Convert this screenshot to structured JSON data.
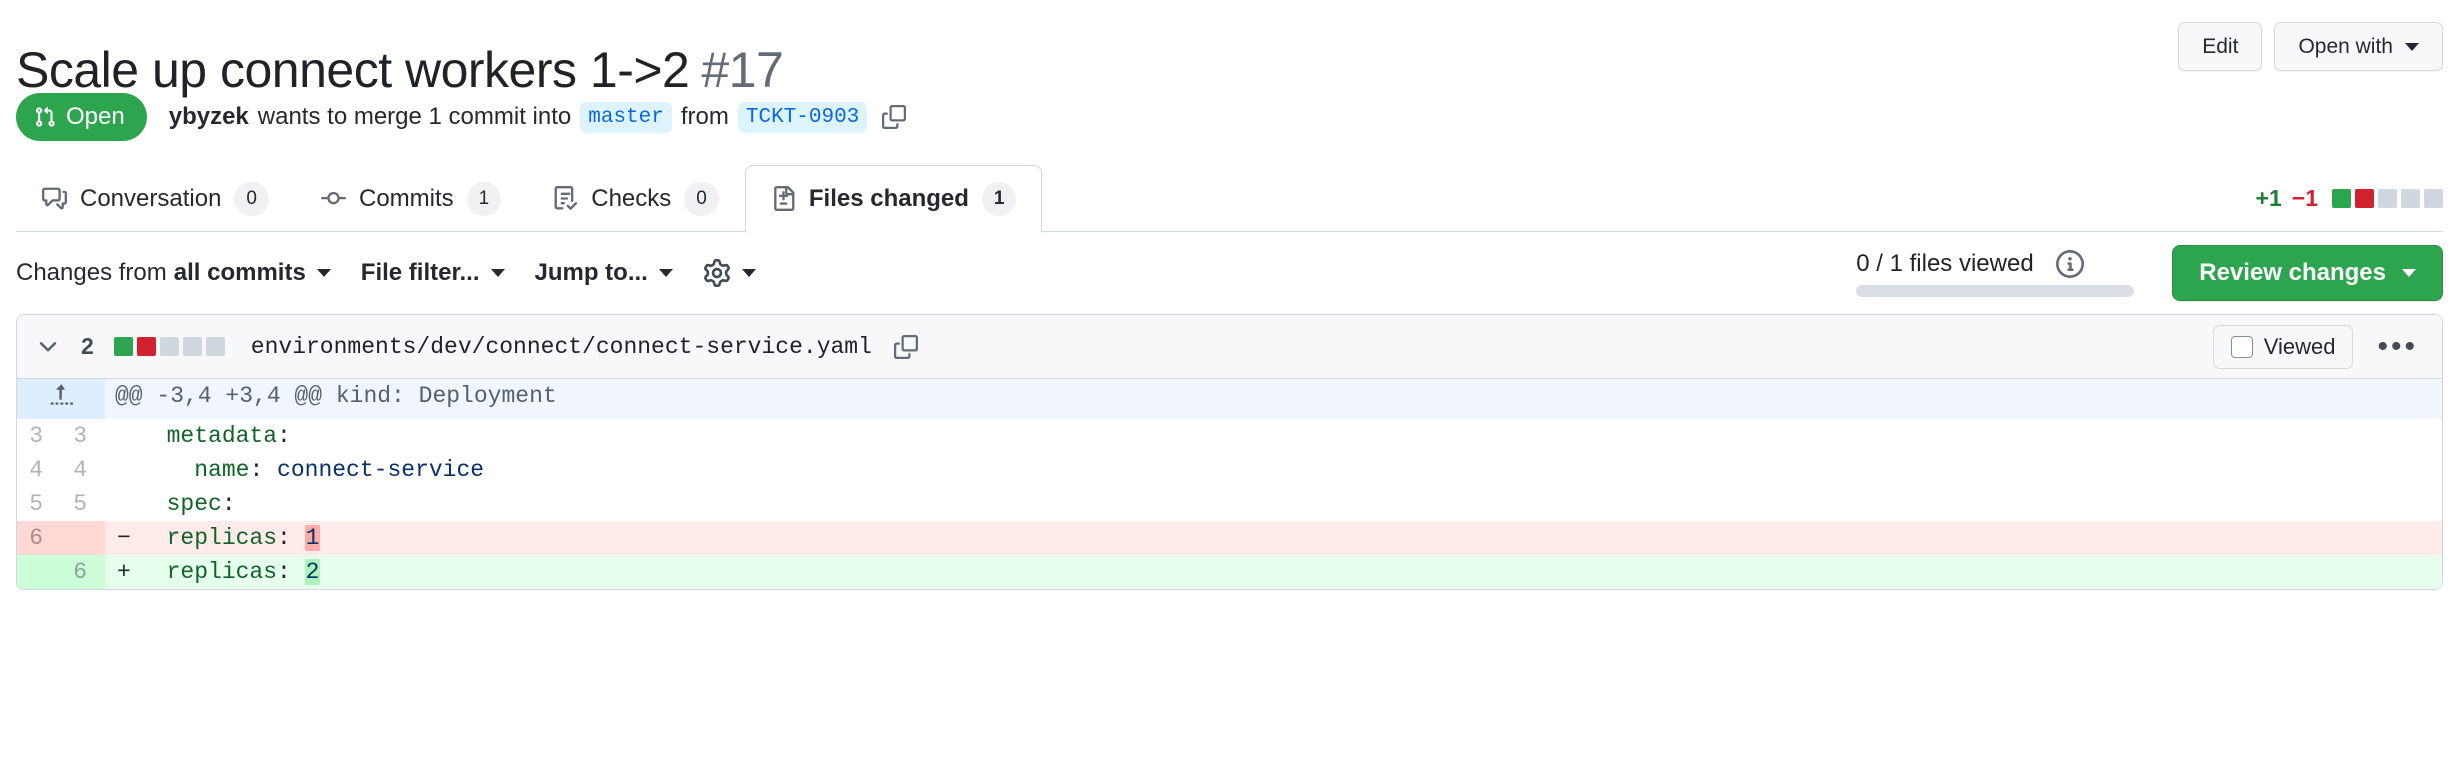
{
  "header": {
    "title": "Scale up connect workers 1->2",
    "number": "#17",
    "edit_label": "Edit",
    "open_with_label": "Open with"
  },
  "status": {
    "state_label": "Open",
    "author": "ybyzek",
    "merge_text_1": "wants to merge 1 commit into",
    "base_branch": "master",
    "merge_text_2": "from",
    "head_branch": "TCKT-0903"
  },
  "tabs": [
    {
      "label": "Conversation",
      "count": "0",
      "icon": "comment-discussion-icon",
      "active": false
    },
    {
      "label": "Commits",
      "count": "1",
      "icon": "git-commit-icon",
      "active": false
    },
    {
      "label": "Checks",
      "count": "0",
      "icon": "checklist-icon",
      "active": false
    },
    {
      "label": "Files changed",
      "count": "1",
      "icon": "file-diff-icon",
      "active": true
    }
  ],
  "diffstat": {
    "additions": "+1",
    "deletions": "−1",
    "blocks": [
      "add",
      "del",
      "neutral",
      "neutral",
      "neutral"
    ]
  },
  "toolbar": {
    "changes_from_prefix": "Changes from",
    "changes_from_value": "all commits",
    "file_filter_label": "File filter...",
    "jump_to_label": "Jump to...",
    "settings_icon": "gear-icon",
    "files_viewed": "0 / 1 files viewed",
    "review_label": "Review changes"
  },
  "file": {
    "change_count": "2",
    "path": "environments/dev/connect/connect-service.yaml",
    "blocks": [
      "add",
      "del",
      "neutral",
      "neutral",
      "neutral"
    ],
    "viewed_label": "Viewed",
    "copy_icon": "copy-icon",
    "kebab_label": "•••"
  },
  "diff": {
    "hunk_header": "@@ -3,4 +3,4 @@ kind: Deployment",
    "rows": [
      {
        "type": "context",
        "old": "3",
        "new": "3",
        "marker": "",
        "indent": "  ",
        "key": "metadata",
        "sep": ":",
        "value": ""
      },
      {
        "type": "context",
        "old": "4",
        "new": "4",
        "marker": "",
        "indent": "    ",
        "key": "name",
        "sep": ": ",
        "value": "connect-service"
      },
      {
        "type": "context",
        "old": "5",
        "new": "5",
        "marker": "",
        "indent": "  ",
        "key": "spec",
        "sep": ":",
        "value": ""
      },
      {
        "type": "del",
        "old": "6",
        "new": "",
        "marker": "−",
        "indent": "  ",
        "key": "replicas",
        "sep": ": ",
        "value": "1"
      },
      {
        "type": "add",
        "old": "",
        "new": "6",
        "marker": "+",
        "indent": "  ",
        "key": "replicas",
        "sep": ": ",
        "value": "2"
      }
    ]
  }
}
